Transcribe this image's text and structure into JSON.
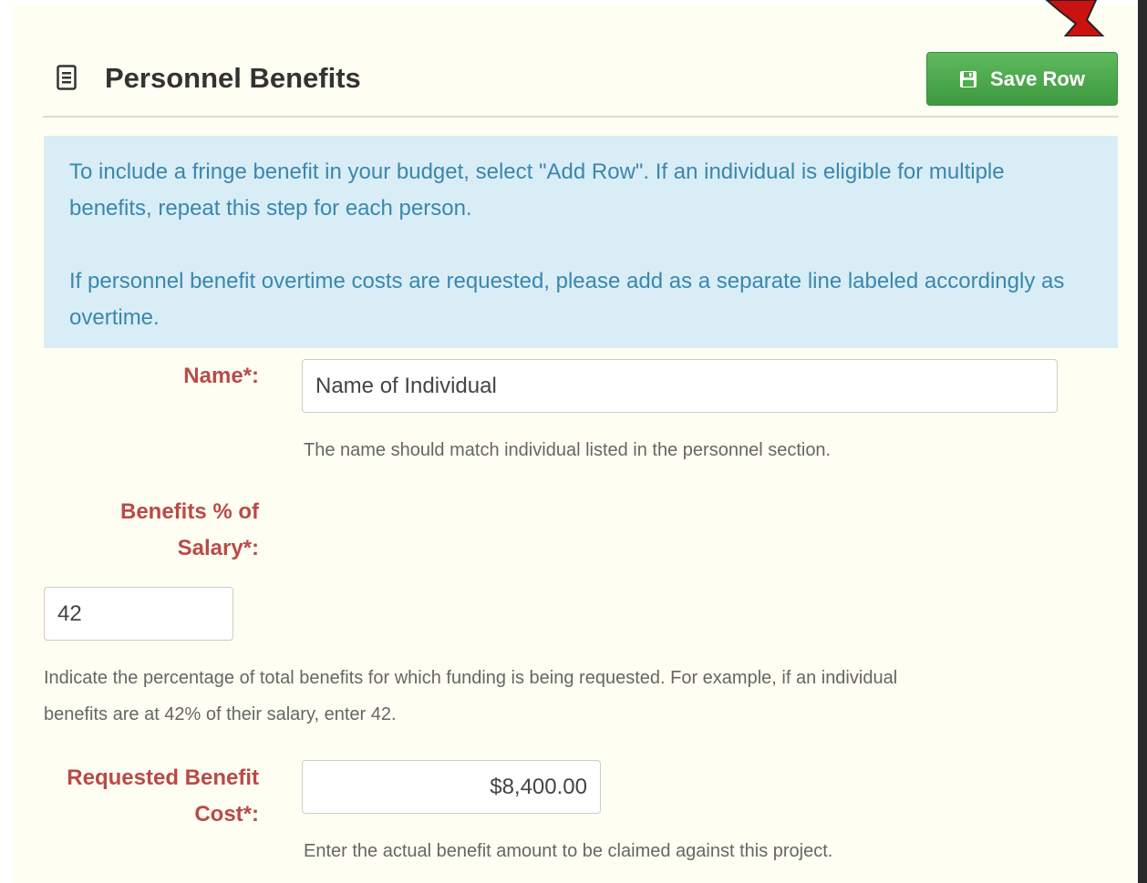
{
  "header": {
    "title": "Personnel Benefits",
    "icon": "document-icon"
  },
  "toolbar": {
    "save_label": "Save Row",
    "save_icon": "floppy-disk-icon"
  },
  "info": {
    "paragraph1": "To include a fringe benefit in your budget, select \"Add Row\". If an individual is eligible for multiple benefits, repeat this step for each person.",
    "paragraph2": "If personnel benefit overtime costs are requested, please add as a separate line labeled accordingly as overtime."
  },
  "form": {
    "name": {
      "label": "Name*:",
      "value": "Name of Individual",
      "help": "The name should match individual listed in the personnel section."
    },
    "benefits_percent": {
      "label_line1": "Benefits % of",
      "label_line2": "Salary*:",
      "value": "42",
      "help_line1": "Indicate the percentage of total benefits for which funding is being requested. For example, if an individual",
      "help_line2": "benefits are at 42% of their salary, enter 42."
    },
    "requested_cost": {
      "label_line1": "Requested Benefit",
      "label_line2": "Cost*:",
      "value": "$8,400.00",
      "help": "Enter the actual benefit amount to be claimed against this project."
    }
  },
  "colors": {
    "panel_bg": "#fefef2",
    "info_bg": "#d9edf7",
    "info_text": "#3a87ad",
    "label_text": "#b94a48",
    "save_button": "#4cae4c",
    "arrow": "#cc1111"
  }
}
